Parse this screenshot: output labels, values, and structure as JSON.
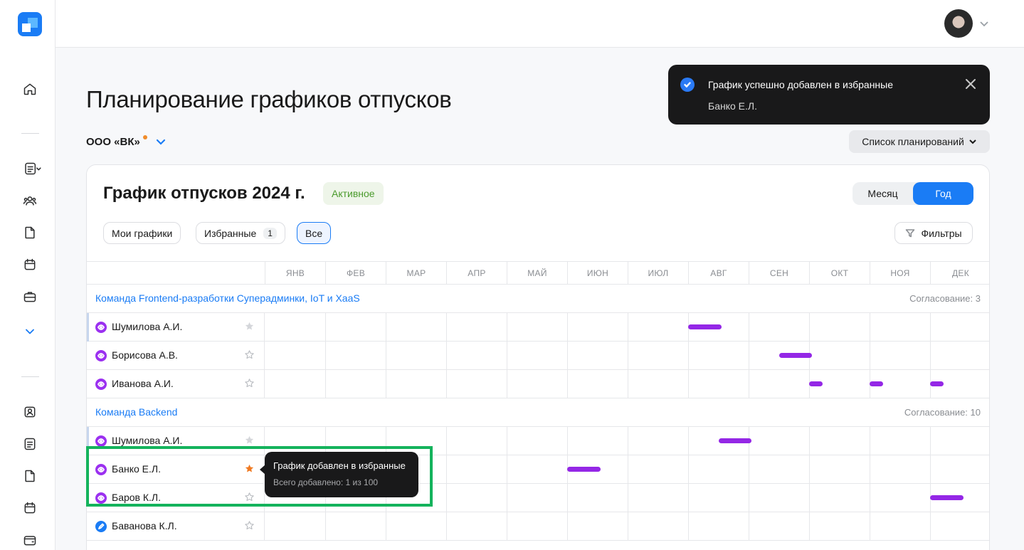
{
  "app": {
    "title": "Планирование графиков отпусков",
    "organization": "ООО «ВК»",
    "plan_list_label": "Список планирований"
  },
  "sidebar": {
    "icons": [
      "home-icon",
      "document-list-icon",
      "users-icon",
      "file-icon",
      "calendar-icon",
      "briefcase-icon",
      "chevron-down-icon",
      "profile-card-icon",
      "document-list-icon",
      "file-icon",
      "calendar-icon",
      "wallet-icon"
    ]
  },
  "toast": {
    "title": "График успешно добавлен в избранные",
    "subtitle": "Банко Е.Л."
  },
  "card": {
    "title": "График отпусков 2024 г.",
    "status": "Активное",
    "view_month": "Месяц",
    "view_year": "Год",
    "filters": {
      "my": "Мои графики",
      "favorites": "Избранные",
      "favorites_count": "1",
      "all": "Все"
    },
    "filter_button": "Фильтры"
  },
  "months": [
    "ЯНВ",
    "ФЕВ",
    "МАР",
    "АПР",
    "МАЙ",
    "ИЮН",
    "ИЮЛ",
    "АВГ",
    "СЕН",
    "ОКТ",
    "НОЯ",
    "ДЕК"
  ],
  "groups": [
    {
      "name": "Команда Frontend-разработки Суперадминки, IoT и XaaS",
      "meta": "Согласование: 3",
      "employees": [
        {
          "name": "Шумилова А.И.",
          "role": "view",
          "star": "filled-gray",
          "bars": [
            {
              "start": 7.0,
              "end": 7.55
            }
          ]
        },
        {
          "name": "Борисова А.В.",
          "role": "view",
          "star": "outline",
          "bars": [
            {
              "start": 8.5,
              "end": 9.05
            }
          ]
        },
        {
          "name": "Иванова А.И.",
          "role": "view",
          "star": "outline",
          "bars": [
            {
              "start": 9.0,
              "end": 9.22
            },
            {
              "start": 10.0,
              "end": 10.22
            },
            {
              "start": 11.0,
              "end": 11.22
            }
          ]
        }
      ]
    },
    {
      "name": "Команда Backend",
      "meta": "Согласование: 10",
      "employees": [
        {
          "name": "Шумилова А.И.",
          "role": "view",
          "star": "filled-gray",
          "bars": [
            {
              "start": 7.5,
              "end": 8.05
            }
          ]
        },
        {
          "name": "Банко Е.Л.",
          "role": "view",
          "star": "filled-orange",
          "bars": [
            {
              "start": 5.0,
              "end": 5.55
            }
          ]
        },
        {
          "name": "Баров К.Л.",
          "role": "view",
          "star": "outline",
          "bars": [
            {
              "start": 11.0,
              "end": 11.55
            }
          ]
        },
        {
          "name": "Баванова К.Л.",
          "role": "edit",
          "star": "outline",
          "bars": []
        }
      ]
    }
  ],
  "tooltip": {
    "title": "График добавлен в избранные",
    "subtitle": "Всего добавлено: 1 из 100"
  },
  "colors": {
    "accent": "#1a7cf5",
    "vacation_bar": "#9427e6",
    "favorite_star": "#f07a22",
    "highlight": "#14b35c"
  }
}
